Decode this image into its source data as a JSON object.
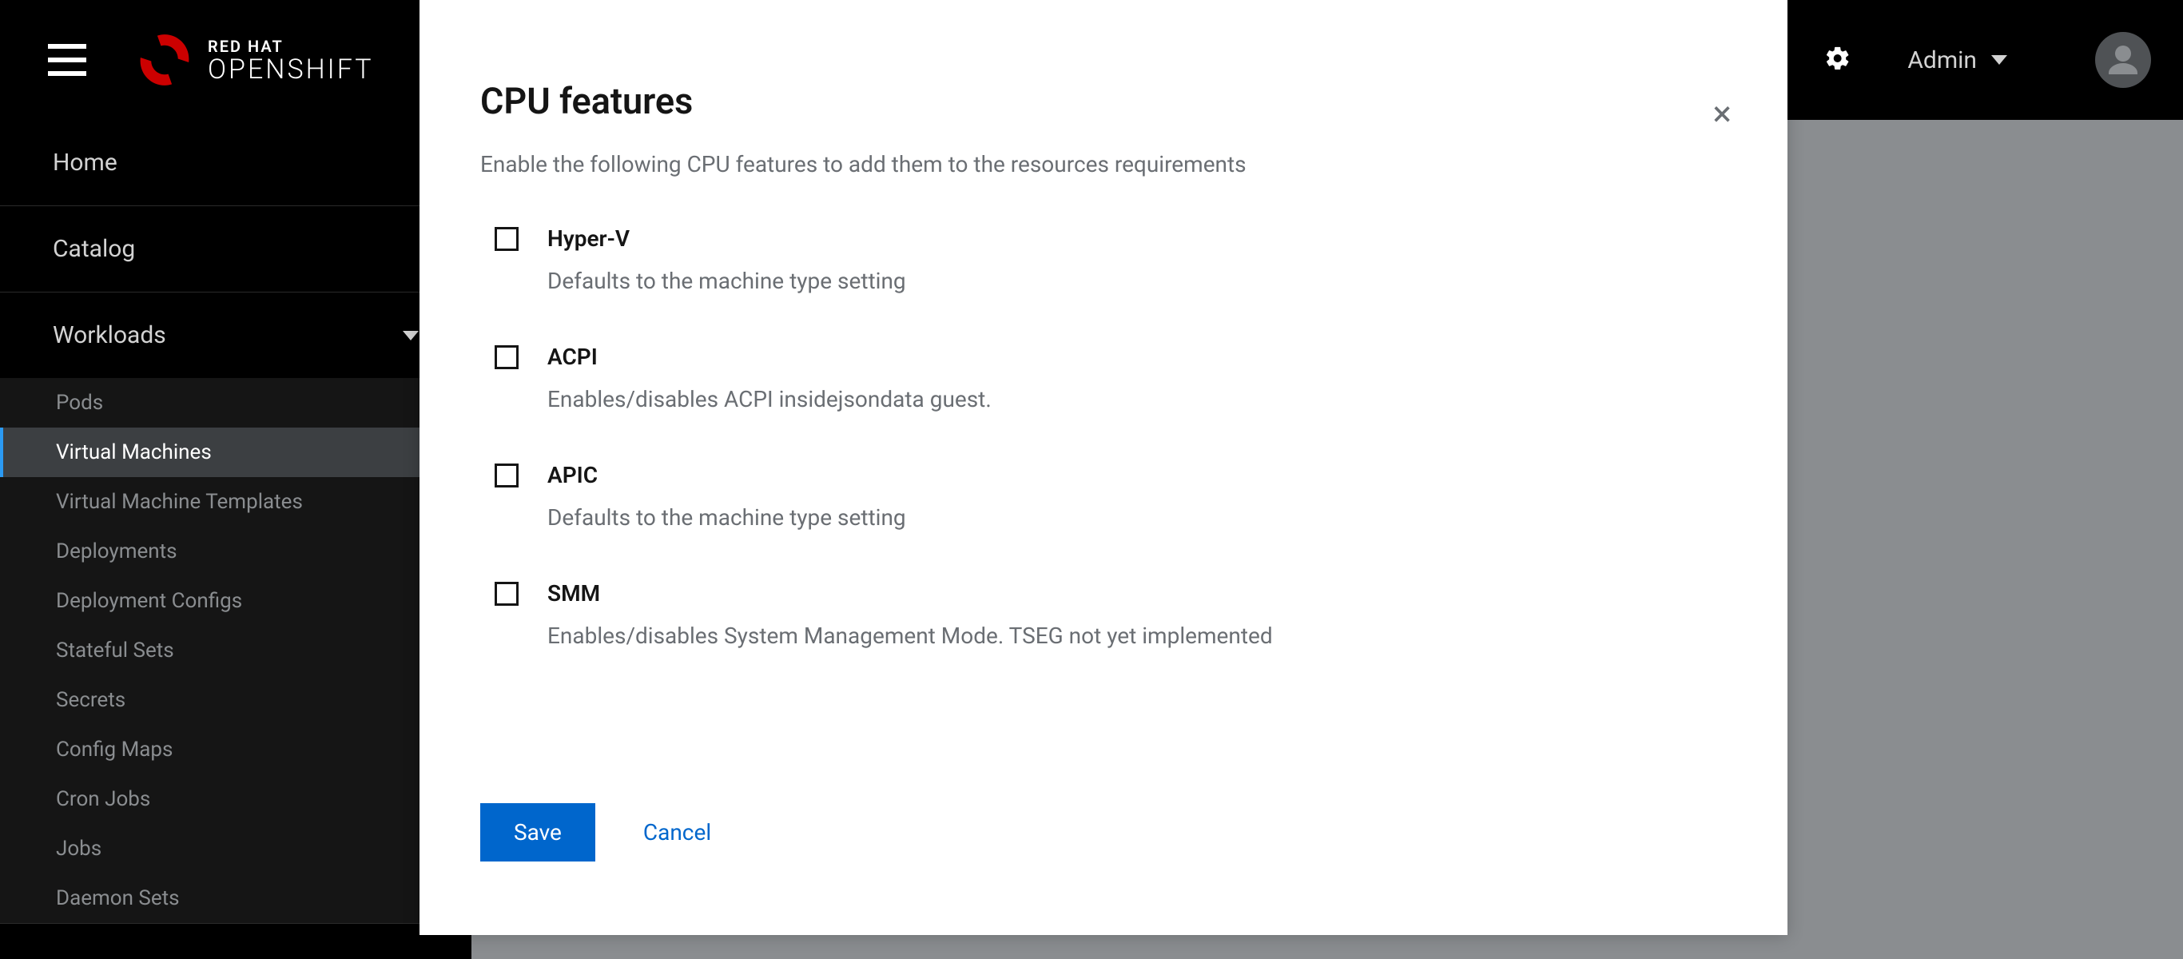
{
  "brand": {
    "line1": "RED HAT",
    "line2": "OPENSHIFT"
  },
  "topbar": {
    "user_label": "Admin"
  },
  "sidebar": {
    "home": "Home",
    "catalog": "Catalog",
    "workloads": "Workloads",
    "sub": {
      "pods": "Pods",
      "vms": "Virtual Machines",
      "vmt": "Virtual Machine Templates",
      "deployments": "Deployments",
      "deployment_configs": "Deployment Configs",
      "stateful_sets": "Stateful Sets",
      "secrets": "Secrets",
      "config_maps": "Config Maps",
      "cron_jobs": "Cron Jobs",
      "jobs": "Jobs",
      "daemon_sets": "Daemon Sets"
    }
  },
  "dialog": {
    "title": "CPU features",
    "subtitle": "Enable the following CPU features to add them to the resources requirements",
    "close": "×",
    "features": [
      {
        "label": "Hyper-V",
        "desc": "Defaults to the machine type setting"
      },
      {
        "label": "ACPI",
        "desc": "Enables/disables ACPI insidejsondata guest."
      },
      {
        "label": "APIC",
        "desc": "Defaults to the machine type setting"
      },
      {
        "label": "SMM",
        "desc": "Enables/disables System Management Mode. TSEG not yet implemented"
      }
    ],
    "save": "Save",
    "cancel": "Cancel"
  }
}
